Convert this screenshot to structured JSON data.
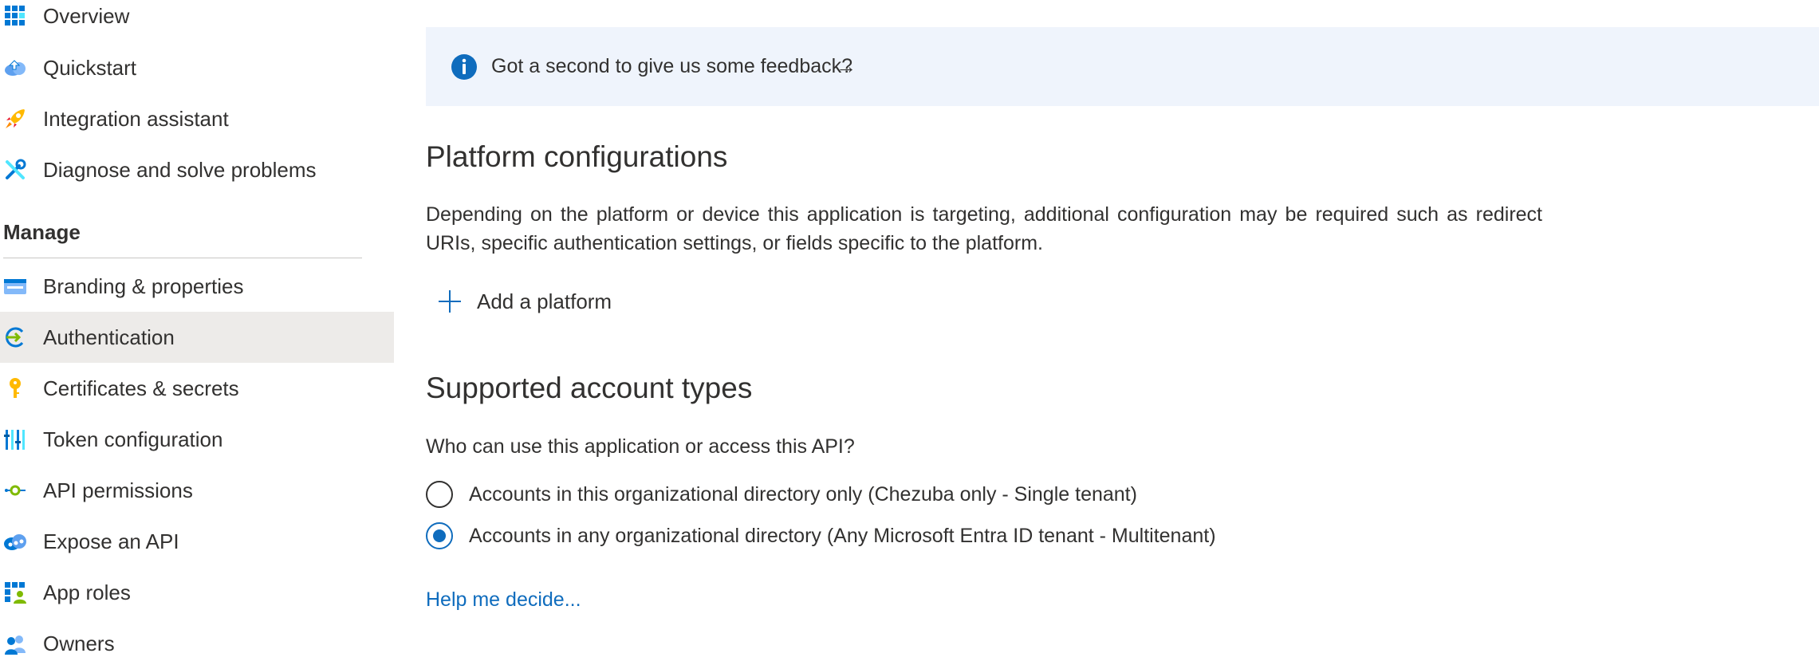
{
  "sidebar": {
    "items": [
      {
        "label": "Overview",
        "icon": "overview-grid-icon"
      },
      {
        "label": "Quickstart",
        "icon": "quickstart-cloud-icon"
      },
      {
        "label": "Integration assistant",
        "icon": "rocket-icon"
      },
      {
        "label": "Diagnose and solve problems",
        "icon": "wrench-icon"
      }
    ],
    "manage_header": "Manage",
    "manage_items": [
      {
        "label": "Branding & properties",
        "icon": "branding-card-icon"
      },
      {
        "label": "Authentication",
        "icon": "authentication-icon",
        "active": true
      },
      {
        "label": "Certificates & secrets",
        "icon": "key-icon"
      },
      {
        "label": "Token configuration",
        "icon": "token-bars-icon"
      },
      {
        "label": "API permissions",
        "icon": "api-permissions-icon"
      },
      {
        "label": "Expose an API",
        "icon": "expose-api-cloud-icon"
      },
      {
        "label": "App roles",
        "icon": "app-roles-icon"
      },
      {
        "label": "Owners",
        "icon": "owners-icon"
      }
    ]
  },
  "feedback": {
    "text": "Got a second to give us some feedback?",
    "arrow": "→"
  },
  "platform": {
    "title": "Platform configurations",
    "description": "Depending on the platform or device this application is targeting, additional configuration may be required such as redirect URIs, specific authentication settings, or fields specific to the platform.",
    "add_label": "Add a platform"
  },
  "account_types": {
    "title": "Supported account types",
    "question": "Who can use this application or access this API?",
    "options": [
      {
        "label": "Accounts in this organizational directory only (Chezuba only - Single tenant)",
        "selected": false
      },
      {
        "label": "Accounts in any organizational directory (Any Microsoft Entra ID tenant - Multitenant)",
        "selected": true
      }
    ],
    "help_link": "Help me decide..."
  },
  "colors": {
    "accent": "#0f6cbd",
    "feedback_bg": "#eff4fc",
    "active_item_bg": "#edebe9",
    "text": "#323130"
  }
}
